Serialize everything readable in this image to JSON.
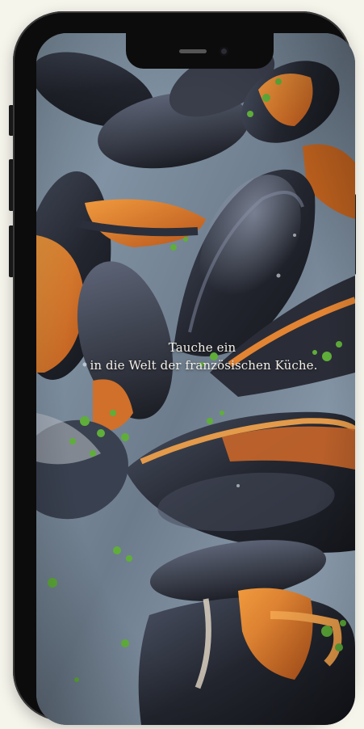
{
  "video": {
    "caption_line1": "Tauche ein",
    "caption_line2": "in die Welt der französischen Küche."
  },
  "colors": {
    "page_background": "#f6f5ec",
    "phone_frame": "#0c0c0c",
    "mussel_shell": "#2a2e3a",
    "mussel_meat": "#e07a2a",
    "parsley": "#5fae3a",
    "plate": "#9fb2c4"
  }
}
